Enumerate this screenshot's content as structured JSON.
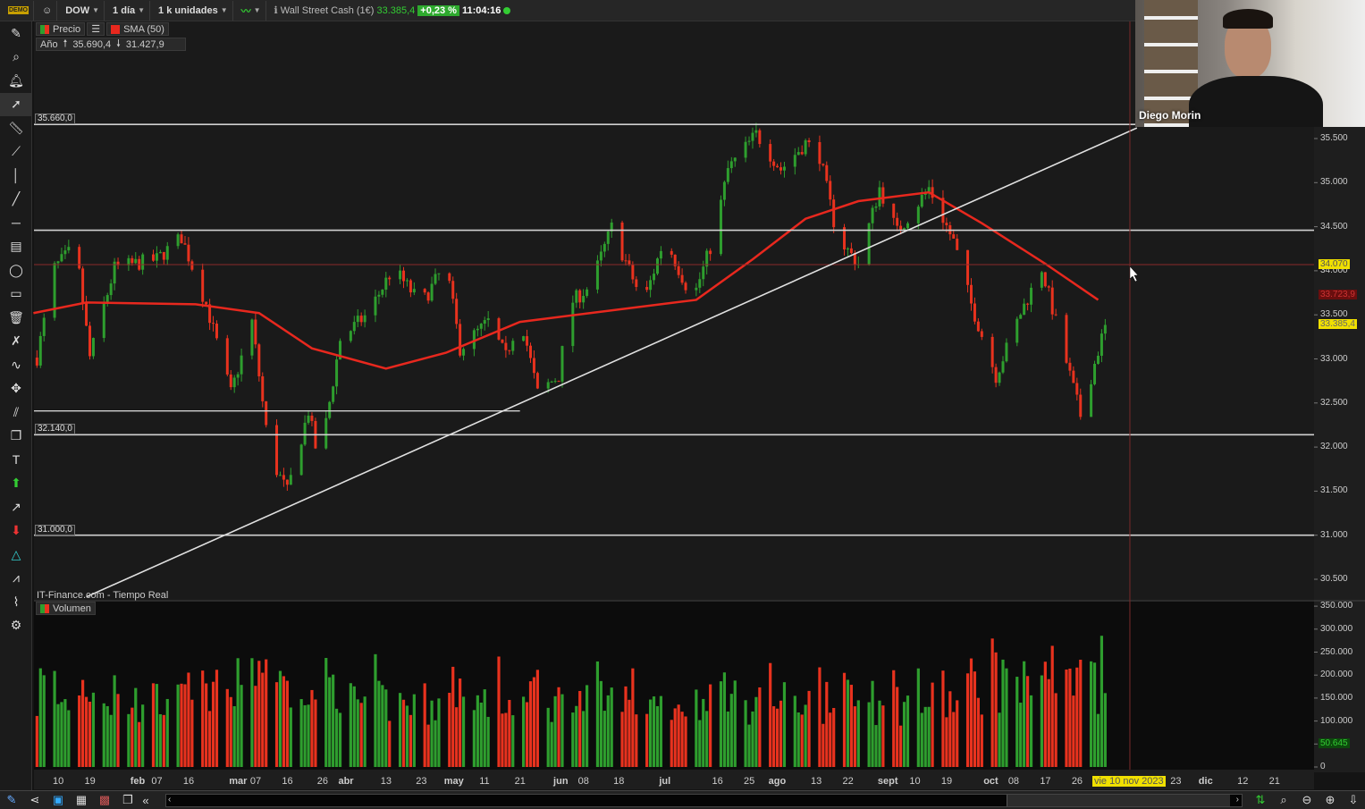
{
  "toolbar": {
    "symbol": "DOW",
    "interval": "1 día",
    "units": "1 k unidades",
    "instrument": "Wall Street Cash (1€)",
    "last_price": "33.385,4",
    "change": "+0,23 %",
    "time": "11:04:16",
    "demo_badge": "DEMO"
  },
  "legend": {
    "price": "Precio",
    "sma": "SMA (50)",
    "period": "Año",
    "high": "35.690,4",
    "low": "31.427,9",
    "source": "IT-Finance.com - Tiempo Real",
    "volume": "Volumen"
  },
  "webcam": {
    "name": "Diego Morin"
  },
  "colors": {
    "up": "#2e9e2e",
    "down": "#e8321e",
    "sma": "#e8281e",
    "hline": "#d0d0d0",
    "highlight": "#f0e000",
    "background": "#141414"
  },
  "chart_data": [
    {
      "type": "candlestick",
      "year": 2023,
      "price_axis": {
        "range": [
          30400,
          35700
        ],
        "ticks": [
          "35.500",
          "35.000",
          "34.500",
          "34.000",
          "33.500",
          "33.000",
          "32.500",
          "32.000",
          "31.500",
          "31.000",
          "30.500"
        ],
        "tick_values": [
          35500,
          35000,
          34500,
          34000,
          33500,
          33000,
          32500,
          32000,
          31500,
          31000,
          30500
        ]
      },
      "price_path": [
        [
          "2023-01-04",
          33015
        ],
        [
          "2023-01-09",
          34030
        ],
        [
          "2023-01-15",
          34280
        ],
        [
          "2023-01-19",
          33020
        ],
        [
          "2023-01-26",
          34030
        ],
        [
          "2023-02-07",
          34130
        ],
        [
          "2023-02-14",
          34380
        ],
        [
          "2023-02-21",
          33620
        ],
        [
          "2023-02-28",
          32610
        ],
        [
          "2023-03-06",
          33420
        ],
        [
          "2023-03-11",
          31900
        ],
        [
          "2023-03-16",
          31490
        ],
        [
          "2023-03-22",
          32410
        ],
        [
          "2023-03-25",
          31800
        ],
        [
          "2023-03-31",
          33220
        ],
        [
          "2023-04-08",
          33520
        ],
        [
          "2023-04-15",
          34030
        ],
        [
          "2023-04-23",
          33620
        ],
        [
          "2023-04-30",
          34080
        ],
        [
          "2023-05-04",
          33120
        ],
        [
          "2023-05-12",
          33420
        ],
        [
          "2023-05-17",
          33020
        ],
        [
          "2023-05-21",
          33520
        ],
        [
          "2023-05-26",
          32610
        ],
        [
          "2023-06-01",
          32810
        ],
        [
          "2023-06-04",
          33620
        ],
        [
          "2023-06-10",
          33830
        ],
        [
          "2023-06-16",
          34490
        ],
        [
          "2023-06-25",
          33620
        ],
        [
          "2023-07-01",
          34380
        ],
        [
          "2023-07-09",
          33670
        ],
        [
          "2023-07-15",
          34380
        ],
        [
          "2023-07-19",
          35150
        ],
        [
          "2023-07-27",
          35550
        ],
        [
          "2023-08-03",
          35150
        ],
        [
          "2023-08-10",
          35450
        ],
        [
          "2023-08-14",
          35300
        ],
        [
          "2023-08-19",
          34380
        ],
        [
          "2023-08-25",
          34080
        ],
        [
          "2023-08-31",
          34940
        ],
        [
          "2023-09-05",
          34440
        ],
        [
          "2023-09-14",
          34940
        ],
        [
          "2023-09-21",
          34330
        ],
        [
          "2023-09-26",
          33620
        ],
        [
          "2023-10-03",
          32810
        ],
        [
          "2023-10-10",
          33520
        ],
        [
          "2023-10-16",
          34030
        ],
        [
          "2023-10-20",
          33420
        ],
        [
          "2023-10-27",
          32360
        ],
        [
          "2023-11-03",
          33385.4
        ]
      ],
      "sma50": [
        [
          "2023-01-03",
          33520
        ],
        [
          "2023-01-18",
          33640
        ],
        [
          "2023-02-18",
          33620
        ],
        [
          "2023-03-08",
          33520
        ],
        [
          "2023-03-23",
          33120
        ],
        [
          "2023-04-13",
          32890
        ],
        [
          "2023-04-30",
          33070
        ],
        [
          "2023-05-21",
          33420
        ],
        [
          "2023-06-20",
          33570
        ],
        [
          "2023-07-10",
          33670
        ],
        [
          "2023-07-26",
          34130
        ],
        [
          "2023-08-10",
          34590
        ],
        [
          "2023-08-25",
          34790
        ],
        [
          "2023-09-14",
          34890
        ],
        [
          "2023-09-29",
          34540
        ],
        [
          "2023-10-17",
          34080
        ],
        [
          "2023-11-01",
          33670
        ]
      ],
      "sma_last": "33.723,9",
      "horizontal_levels": [
        {
          "value": 35660,
          "label": "35.660,0"
        },
        {
          "value": 34460,
          "label": ""
        },
        {
          "value": 32140,
          "label": "32.140,0"
        },
        {
          "value": 31000,
          "label": "31.000,0"
        }
      ],
      "short_level": {
        "value": 32410,
        "from": "2023-01-03",
        "to": "2023-05-21"
      },
      "cursor_level": {
        "value": 34070,
        "label": "34.070"
      },
      "trendline": [
        [
          "2023-01-18",
          30300
        ],
        [
          "2023-11-12",
          35620
        ]
      ],
      "cursor_date": "vie 10 nov 2023",
      "x_ticks": [
        [
          "2023-01-10",
          "10"
        ],
        [
          "2023-01-19",
          "19"
        ],
        [
          "2023-02-01",
          "feb"
        ],
        [
          "2023-02-07",
          "07"
        ],
        [
          "2023-02-16",
          "16"
        ],
        [
          "2023-03-01",
          "mar"
        ],
        [
          "2023-03-07",
          "07"
        ],
        [
          "2023-03-16",
          "16"
        ],
        [
          "2023-03-26",
          "26"
        ],
        [
          "2023-04-01",
          "abr"
        ],
        [
          "2023-04-13",
          "13"
        ],
        [
          "2023-04-23",
          "23"
        ],
        [
          "2023-05-01",
          "may"
        ],
        [
          "2023-05-11",
          "11"
        ],
        [
          "2023-05-21",
          "21"
        ],
        [
          "2023-06-01",
          "jun"
        ],
        [
          "2023-06-08",
          "08"
        ],
        [
          "2023-06-18",
          "18"
        ],
        [
          "2023-07-01",
          "jul"
        ],
        [
          "2023-07-16",
          "16"
        ],
        [
          "2023-07-25",
          "25"
        ],
        [
          "2023-08-01",
          "ago"
        ],
        [
          "2023-08-13",
          "13"
        ],
        [
          "2023-08-22",
          "22"
        ],
        [
          "2023-09-01",
          "sept"
        ],
        [
          "2023-09-10",
          "10"
        ],
        [
          "2023-09-19",
          "19"
        ],
        [
          "2023-10-01",
          "oct"
        ],
        [
          "2023-10-08",
          "08"
        ],
        [
          "2023-10-17",
          "17"
        ],
        [
          "2023-10-26",
          "26"
        ],
        [
          "2023-11-23",
          "23"
        ],
        [
          "2023-12-01",
          "dic"
        ],
        [
          "2023-12-12",
          "12"
        ],
        [
          "2023-12-21",
          "21"
        ]
      ],
      "last_price_label": "33.385,4"
    },
    {
      "type": "bar",
      "title": "Volumen",
      "volume_axis": {
        "range": [
          0,
          350000
        ],
        "ticks": [
          "350.000",
          "300.000",
          "250.000",
          "200.000",
          "150.000",
          "100.000",
          "50.000",
          "0"
        ],
        "tick_values": [
          350000,
          300000,
          250000,
          200000,
          150000,
          100000,
          50000,
          0
        ]
      },
      "last_volume": "50.645"
    }
  ]
}
